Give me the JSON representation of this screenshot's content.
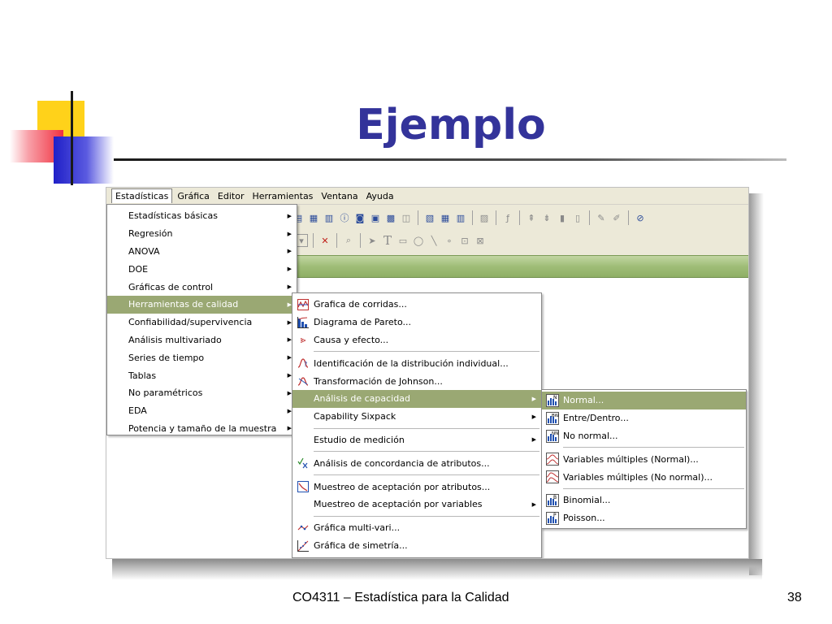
{
  "slide": {
    "title": "Ejemplo",
    "footer": "CO4311 – Estadística para la Calidad",
    "page_number": "38"
  },
  "menubar": {
    "items": [
      {
        "label": "Estadísticas",
        "active": true
      },
      {
        "label": "Gráfica"
      },
      {
        "label": "Editor"
      },
      {
        "label": "Herramientas"
      },
      {
        "label": "Ventana"
      },
      {
        "label": "Ayuda"
      }
    ]
  },
  "menu_estadisticas": {
    "items": [
      {
        "label": "Estadísticas básicas"
      },
      {
        "label": "Regresión"
      },
      {
        "label": "ANOVA"
      },
      {
        "label": "DOE"
      },
      {
        "label": "Gráficas de control"
      },
      {
        "label": "Herramientas de calidad",
        "highlighted": true
      },
      {
        "label": "Confiabilidad/supervivencia"
      },
      {
        "label": "Análisis multivariado"
      },
      {
        "label": "Series de tiempo"
      },
      {
        "label": "Tablas"
      },
      {
        "label": "No paramétricos"
      },
      {
        "label": "EDA"
      },
      {
        "label": "Potencia y tamaño de la muestra"
      }
    ]
  },
  "menu_herramientas_calidad": {
    "items": [
      {
        "label": "Grafica de corridas...",
        "icon": "run-chart-icon"
      },
      {
        "label": "Diagrama de Pareto...",
        "icon": "pareto-icon"
      },
      {
        "label": "Causa y efecto...",
        "icon": "fishbone-icon"
      },
      {
        "label": "Identificación de la distribución individual...",
        "icon": "distribution-id-icon"
      },
      {
        "label": "Transformación de Johnson...",
        "icon": "johnson-icon"
      },
      {
        "label": "Análisis de capacidad",
        "highlighted": true
      },
      {
        "label": "Capability Sixpack"
      },
      {
        "label": "Estudio de medición"
      },
      {
        "label": "Análisis de concordancia de atributos...",
        "icon": "attribute-agreement-icon"
      },
      {
        "label": "Muestreo de aceptación por atributos...",
        "icon": "acceptance-sampling-icon"
      },
      {
        "label": "Muestreo de aceptación por variables"
      },
      {
        "label": "Gráfica multi-vari...",
        "icon": "multi-vari-icon"
      },
      {
        "label": "Gráfica de simetría...",
        "icon": "symmetry-icon"
      }
    ]
  },
  "menu_analisis_capacidad": {
    "items": [
      {
        "label": "Normal...",
        "icon_letter": "N",
        "highlighted": true
      },
      {
        "label": "Entre/Dentro...",
        "icon_letter": "BW"
      },
      {
        "label": "No normal...",
        "icon_letter": "NN"
      },
      {
        "label": "Variables múltiples (Normal)..."
      },
      {
        "label": "Variables múltiples (No normal)..."
      },
      {
        "label": "Binomial...",
        "icon_letter": "B"
      },
      {
        "label": "Poisson...",
        "icon_letter": "P"
      }
    ]
  },
  "colors": {
    "title": "#33339a",
    "menu_highlight": "#9aa873",
    "window_chrome": "#ece9d8",
    "toolbar_green": "#9fbd77"
  }
}
